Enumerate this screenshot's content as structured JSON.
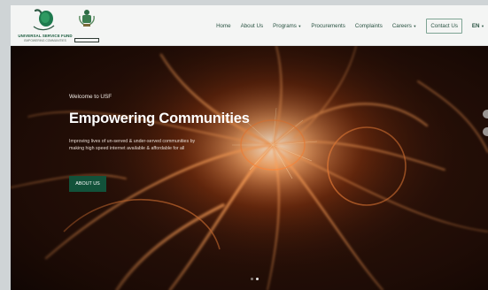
{
  "header": {
    "logo_title": "UNIVERSAL SERVICE FUND",
    "logo_subtitle": "EMPOWERING COMMUNITIES",
    "gov_text": "",
    "gov_badge": ""
  },
  "nav": {
    "items": [
      {
        "label": "Home",
        "dropdown": false
      },
      {
        "label": "About Us",
        "dropdown": false
      },
      {
        "label": "Programs",
        "dropdown": true
      },
      {
        "label": "Procurements",
        "dropdown": false
      },
      {
        "label": "Complaints",
        "dropdown": false
      },
      {
        "label": "Careers",
        "dropdown": true
      }
    ],
    "contact_label": "Contact Us",
    "language": "EN"
  },
  "hero": {
    "kicker": "Welcome to USF",
    "title": "Empowering Communities",
    "description": "Improving lives of un-served & under-served communities by making high speed internet available & affordable for all",
    "button_label": "ABOUT US",
    "slides_total": 2,
    "active_slide": 1
  },
  "colors": {
    "brand_green": "#12523a",
    "nav_text": "#2a5443",
    "hero_glow": "#ff8a3d"
  }
}
